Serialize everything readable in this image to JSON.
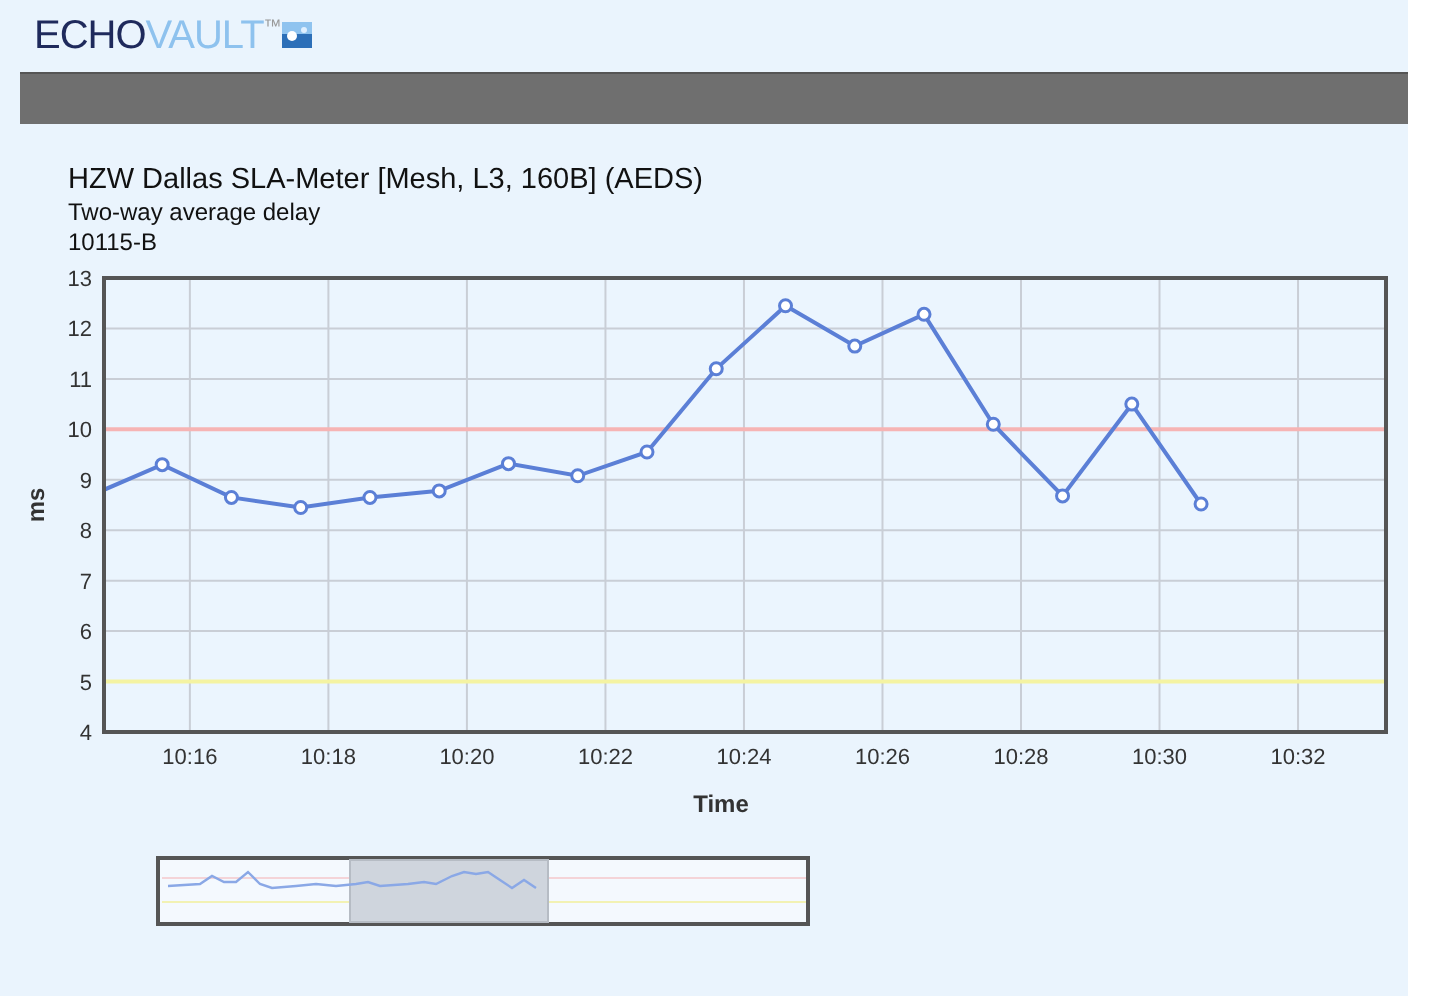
{
  "logo": {
    "word_1": "ECHO",
    "word_2": "VAULT",
    "mark": "™"
  },
  "report": {
    "title": "HZW Dallas SLA-Meter [Mesh, L3, 160B] (AEDS)",
    "subtitle": "Two-way average delay",
    "id": "10115-B"
  },
  "chart_data": {
    "type": "line",
    "xlabel": "Time",
    "ylabel": "ms",
    "xlim": [
      614.76,
      633.27
    ],
    "ylim": [
      4,
      13
    ],
    "xticks": [
      {
        "value": 616,
        "label": "10:16"
      },
      {
        "value": 618,
        "label": "10:18"
      },
      {
        "value": 620,
        "label": "10:20"
      },
      {
        "value": 622,
        "label": "10:22"
      },
      {
        "value": 624,
        "label": "10:24"
      },
      {
        "value": 626,
        "label": "10:26"
      },
      {
        "value": 628,
        "label": "10:28"
      },
      {
        "value": 630,
        "label": "10:30"
      },
      {
        "value": 632,
        "label": "10:32"
      }
    ],
    "yticks": [
      4,
      5,
      6,
      7,
      8,
      9,
      10,
      11,
      12,
      13
    ],
    "grid": true,
    "x": [
      614.76,
      615.6,
      616.6,
      617.6,
      618.6,
      619.6,
      620.6,
      621.6,
      622.6,
      623.6,
      624.6,
      625.6,
      626.6,
      627.6,
      628.6,
      629.6,
      630.6
    ],
    "series": [
      {
        "color": "#5b7fd6",
        "marker": true,
        "values": [
          8.8,
          9.3,
          8.65,
          8.45,
          8.65,
          8.78,
          9.32,
          9.08,
          9.55,
          11.2,
          12.45,
          11.65,
          12.28,
          10.1,
          8.68,
          10.5,
          8.52
        ]
      }
    ],
    "ref_lines": [
      {
        "axis": "y",
        "value": 10,
        "color": "#f6b4b4"
      },
      {
        "axis": "y",
        "value": 5,
        "color": "#f4f3a2"
      }
    ]
  }
}
